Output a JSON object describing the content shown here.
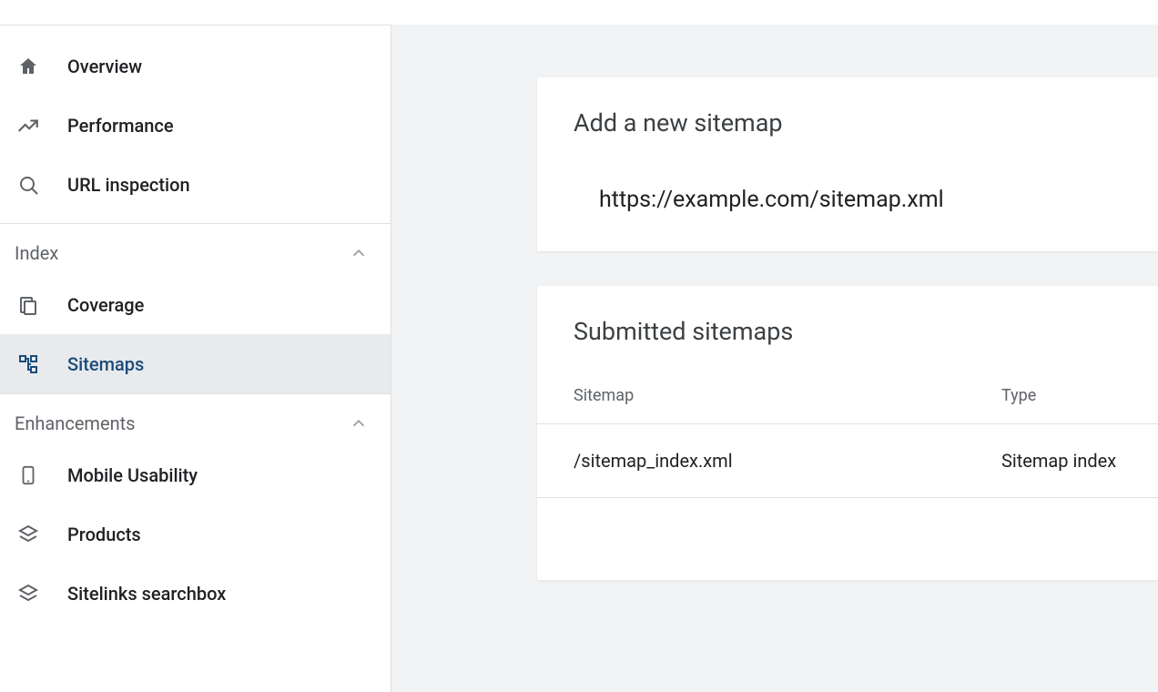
{
  "sidebar": {
    "main_items": [
      {
        "label": "Overview",
        "icon": "home"
      },
      {
        "label": "Performance",
        "icon": "trend"
      },
      {
        "label": "URL inspection",
        "icon": "search"
      }
    ],
    "sections": [
      {
        "label": "Index",
        "items": [
          {
            "label": "Coverage",
            "icon": "copy",
            "active": false
          },
          {
            "label": "Sitemaps",
            "icon": "sitemap",
            "active": true
          }
        ]
      },
      {
        "label": "Enhancements",
        "items": [
          {
            "label": "Mobile Usability",
            "icon": "mobile",
            "active": false
          },
          {
            "label": "Products",
            "icon": "layers",
            "active": false
          },
          {
            "label": "Sitelinks searchbox",
            "icon": "layers",
            "active": false
          }
        ]
      }
    ]
  },
  "main": {
    "add_card": {
      "title": "Add a new sitemap",
      "input_value": "https://example.com/sitemap.xml"
    },
    "list_card": {
      "title": "Submitted sitemaps",
      "columns": {
        "sitemap": "Sitemap",
        "type": "Type"
      },
      "rows": [
        {
          "sitemap": "/sitemap_index.xml",
          "type": "Sitemap index"
        }
      ]
    }
  }
}
